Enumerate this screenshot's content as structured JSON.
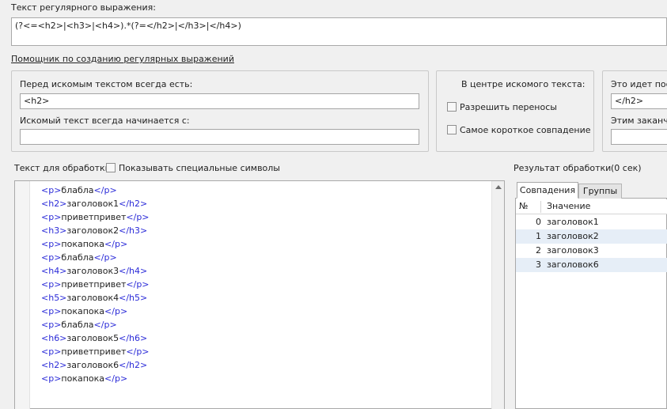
{
  "regex": {
    "label": "Текст регулярного выражения:",
    "value": "(?<=<h2>|<h3>|<h4>).*(?=</h2>|</h3>|</h4>)"
  },
  "helper": {
    "link": "Помощник по созданию регулярных выражений",
    "before": {
      "label": "Перед искомым текстом всегда есть:",
      "value": "<h2>",
      "starts_label": "Искомый текст всегда начинается с:",
      "starts_value": ""
    },
    "center": {
      "label": "В центре искомого текста:",
      "allow_wrap": "Разрешить переносы",
      "shortest": "Самое короткое совпадение"
    },
    "after": {
      "label": "Это идет посл",
      "value": "</h2>",
      "ends_label": "Этим заканчи",
      "ends_value": ""
    }
  },
  "source": {
    "label": "Текст для обработки",
    "show_special": "Показывать специальные символы",
    "lines": [
      {
        "open": "<p>",
        "text": "блабла",
        "close": "</p>"
      },
      {
        "open": "<h2>",
        "text": "заголовок1",
        "close": "</h2>"
      },
      {
        "open": "<p>",
        "text": "приветпривет",
        "close": "</p>"
      },
      {
        "open": "<h3>",
        "text": "заголовок2",
        "close": "</h3>"
      },
      {
        "open": "<p>",
        "text": "покапока",
        "close": "</p>"
      },
      {
        "open": "<p>",
        "text": "блабла",
        "close": "</p>"
      },
      {
        "open": "<h4>",
        "text": "заголовок3",
        "close": "</h4>"
      },
      {
        "open": "<p>",
        "text": "приветпривет",
        "close": "</p>"
      },
      {
        "open": "<h5>",
        "text": "заголовок4",
        "close": "</h5>"
      },
      {
        "open": "<p>",
        "text": "покапока",
        "close": "</p>"
      },
      {
        "open": "<p>",
        "text": "блабла",
        "close": "</p>"
      },
      {
        "open": "<h6>",
        "text": "заголовок5",
        "close": "</h6>"
      },
      {
        "open": "<p>",
        "text": "приветпривет",
        "close": "</p>"
      },
      {
        "open": "<h2>",
        "text": "заголовок6",
        "close": "</h2>"
      },
      {
        "open": "<p>",
        "text": "покапока",
        "close": "</p>"
      }
    ]
  },
  "result": {
    "label": "Результат обработки",
    "time": "(0 сек)",
    "tabs": [
      "Совпадения",
      "Группы"
    ],
    "columns": [
      "№",
      "Значение"
    ],
    "rows": [
      {
        "idx": "0",
        "value": "заголовок1"
      },
      {
        "idx": "1",
        "value": "заголовок2"
      },
      {
        "idx": "2",
        "value": "заголовок3"
      },
      {
        "idx": "3",
        "value": "заголовок6"
      }
    ]
  },
  "colors": {
    "tag": "#2b2bd8",
    "row_alt": "#e6eef7",
    "link": "#000000"
  },
  "icons": {
    "scroll_up": "triangle-up-icon"
  }
}
